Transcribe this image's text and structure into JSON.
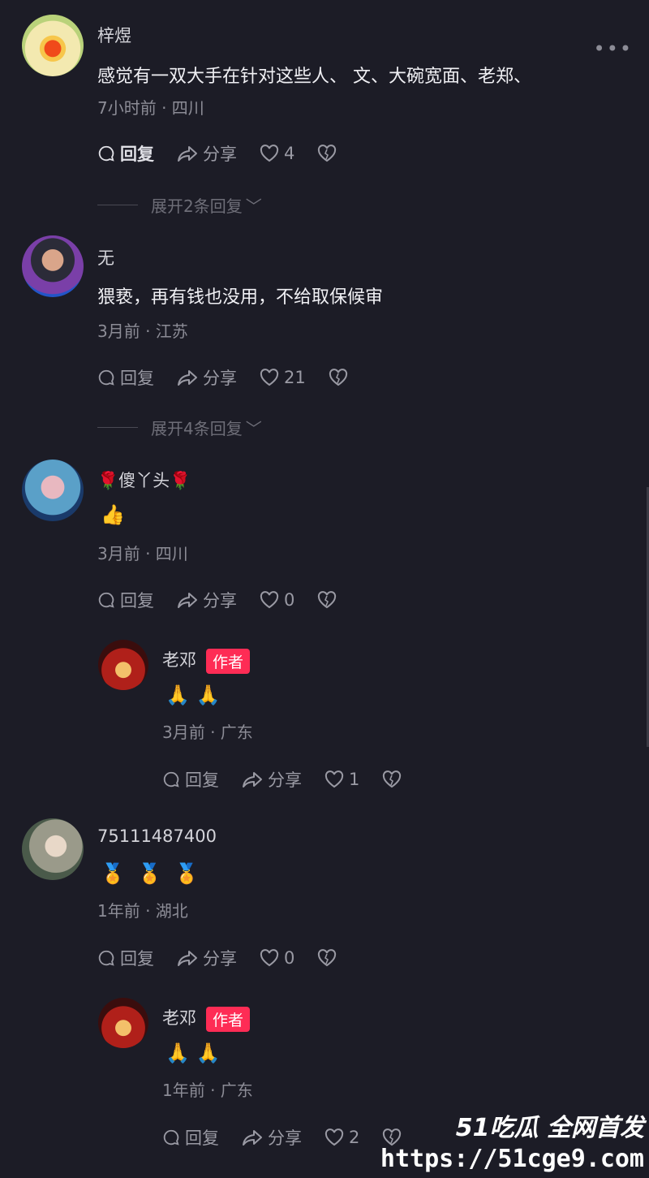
{
  "comments": [
    {
      "name": "梓煜",
      "text": "感觉有一双大手在针对这些人、 文、大碗宽面、老郑、",
      "meta": "7小时前 · 四川",
      "reply": "回复",
      "share": "分享",
      "likes": "4",
      "expand": "展开2条回复"
    },
    {
      "name": "无",
      "text": "猥亵，再有钱也没用，不给取保候审",
      "meta": "3月前 · 江苏",
      "reply": "回复",
      "share": "分享",
      "likes": "21",
      "expand": "展开4条回复"
    },
    {
      "name": "傻丫头",
      "text": "👍",
      "meta": "3月前 · 四川",
      "reply": "回复",
      "share": "分享",
      "likes": "0"
    },
    {
      "name": "老邓",
      "tag": "作者",
      "text": "🙏 🙏",
      "meta": "3月前 · 广东",
      "reply": "回复",
      "share": "分享",
      "likes": "1"
    },
    {
      "name": "75111487400",
      "text": "🏅 🏅 🏅",
      "meta": "1年前 · 湖北",
      "reply": "回复",
      "share": "分享",
      "likes": "0"
    },
    {
      "name": "老邓",
      "tag": "作者",
      "text": "🙏 🙏",
      "meta": "1年前 · 广东",
      "reply": "回复",
      "share": "分享",
      "likes": "2"
    }
  ],
  "watermark": {
    "brand": "51吃瓜 全网首发",
    "url": "https://51cge9.com"
  },
  "colors": {
    "background": "#1c1c26",
    "author_tag": "#fe2c55"
  }
}
